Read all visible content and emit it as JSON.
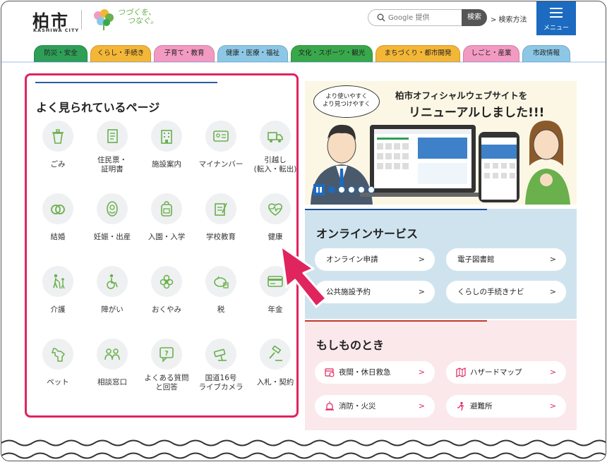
{
  "header": {
    "logo_kanji": "柏市",
    "logo_sub": "KASHIWA CITY",
    "logo_tagline_1": "つづくを、",
    "logo_tagline_2": "つなぐ。",
    "search_placeholder": "Google 提供",
    "search_button": "検索",
    "search_help": "> 検索方法",
    "menu_label": "メニュー"
  },
  "tabs": [
    {
      "label": "防災・安全",
      "color": "#2f9e57"
    },
    {
      "label": "くらし・手続き",
      "color": "#f3b637"
    },
    {
      "label": "子育て・教育",
      "color": "#f29ac2"
    },
    {
      "label": "健康・医療・福祉",
      "color": "#8cc8e6"
    },
    {
      "label": "文化・スポーツ・観光",
      "color": "#38a84b"
    },
    {
      "label": "まちづくり・都市開発",
      "color": "#f3b637"
    },
    {
      "label": "しごと・産業",
      "color": "#f29ac2"
    },
    {
      "label": "市政情報",
      "color": "#8cc8e6"
    }
  ],
  "popular": {
    "title": "よく見られているページ",
    "items": [
      {
        "label": "ごみ",
        "icon": "trash-icon"
      },
      {
        "label": "住民票・\n証明書",
        "icon": "document-icon"
      },
      {
        "label": "施設案内",
        "icon": "building-icon"
      },
      {
        "label": "マイナンバー",
        "icon": "id-card-icon"
      },
      {
        "label": "引越し\n(転入・転出)",
        "icon": "truck-icon"
      },
      {
        "label": "結婚",
        "icon": "rings-icon"
      },
      {
        "label": "妊娠・出産",
        "icon": "baby-icon"
      },
      {
        "label": "入園・入学",
        "icon": "backpack-icon"
      },
      {
        "label": "学校教育",
        "icon": "notebook-icon"
      },
      {
        "label": "健康",
        "icon": "heart-pulse-icon"
      },
      {
        "label": "介護",
        "icon": "elderly-icon"
      },
      {
        "label": "障がい",
        "icon": "wheelchair-icon"
      },
      {
        "label": "おくやみ",
        "icon": "flower-icon"
      },
      {
        "label": "税",
        "icon": "tax-piggy-icon"
      },
      {
        "label": "年金",
        "icon": "pension-card-icon"
      },
      {
        "label": "ペット",
        "icon": "dog-icon"
      },
      {
        "label": "相談窓口",
        "icon": "consult-icon"
      },
      {
        "label": "よくある質問\nと回答",
        "icon": "faq-icon"
      },
      {
        "label": "国道16号\nライブカメラ",
        "icon": "camera-icon"
      },
      {
        "label": "入札・契約",
        "icon": "gavel-icon"
      }
    ]
  },
  "banner": {
    "bubble_1": "より使いやすく",
    "bubble_2": "より見つけやすく",
    "title_1": "柏市オフィシャルウェブサイトを",
    "title_2": "リニューアルしました!!!"
  },
  "online": {
    "title": "オンラインサービス",
    "items": [
      "オンライン申請",
      "電子図書館",
      "公共施設予約",
      "くらしの手続きナビ"
    ]
  },
  "emergency": {
    "title": "もしものとき",
    "items": [
      {
        "label": "夜間・休日救急",
        "icon": "calendar-clock-icon"
      },
      {
        "label": "ハザードマップ",
        "icon": "map-icon"
      },
      {
        "label": "消防・火災",
        "icon": "siren-icon"
      },
      {
        "label": "避難所",
        "icon": "evacuation-icon"
      }
    ]
  },
  "colors": {
    "accent_blue": "#1c6bc0",
    "highlight_pink": "#e0245e",
    "icon_green": "#6ab04c"
  }
}
